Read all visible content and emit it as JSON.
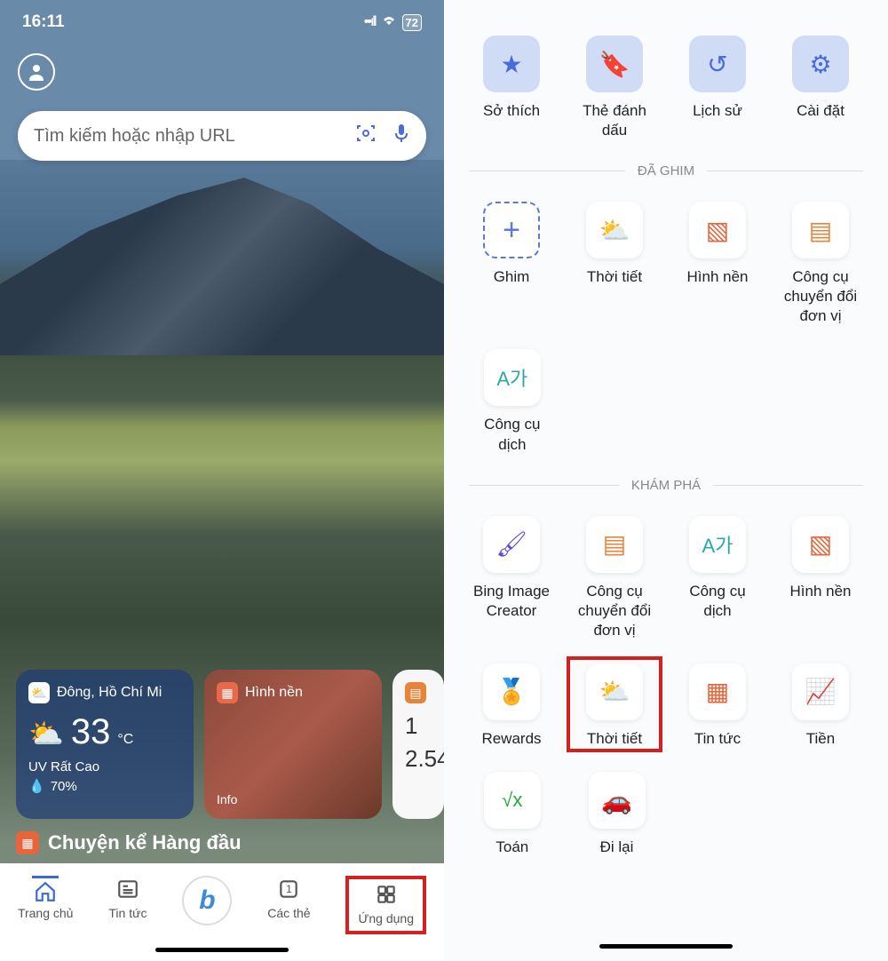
{
  "status": {
    "time": "16:11",
    "battery": "72"
  },
  "search": {
    "placeholder": "Tìm kiếm hoặc nhập URL"
  },
  "weather_widget": {
    "location": "Đông, Hồ Chí Mi",
    "temp": "33",
    "unit": "°C",
    "uv": "UV Rất Cao",
    "humidity": "70%"
  },
  "wallpaper_widget": {
    "title": "Hình nền",
    "info": "Info"
  },
  "partial_widget": {
    "row1": "1",
    "row2": "2.54"
  },
  "top_stories": {
    "title": "Chuyện kể Hàng đầu"
  },
  "nav": {
    "home": "Trang chủ",
    "news": "Tin tức",
    "tabs": "Các thẻ",
    "tabs_count": "1",
    "apps": "Ứng dụng"
  },
  "right": {
    "top": {
      "interests": "Sở thích",
      "bookmarks": "Thẻ đánh dấu",
      "history": "Lịch sử",
      "settings": "Cài đặt"
    },
    "section_pinned": "ĐÃ GHIM",
    "pinned": {
      "pin": "Ghim",
      "weather": "Thời tiết",
      "wallpaper": "Hình nền",
      "unit": "Công cụ chuyển đổi đơn vị",
      "translate": "Công cụ dịch"
    },
    "section_explore": "KHÁM PHÁ",
    "explore": {
      "image_creator": "Bing Image Creator",
      "unit": "Công cụ chuyển đổi đơn vị",
      "translate": "Công cụ dịch",
      "wallpaper": "Hình nền",
      "rewards": "Rewards",
      "weather": "Thời tiết",
      "news": "Tin tức",
      "money": "Tiền",
      "math": "Toán",
      "commute": "Đi lại"
    }
  }
}
